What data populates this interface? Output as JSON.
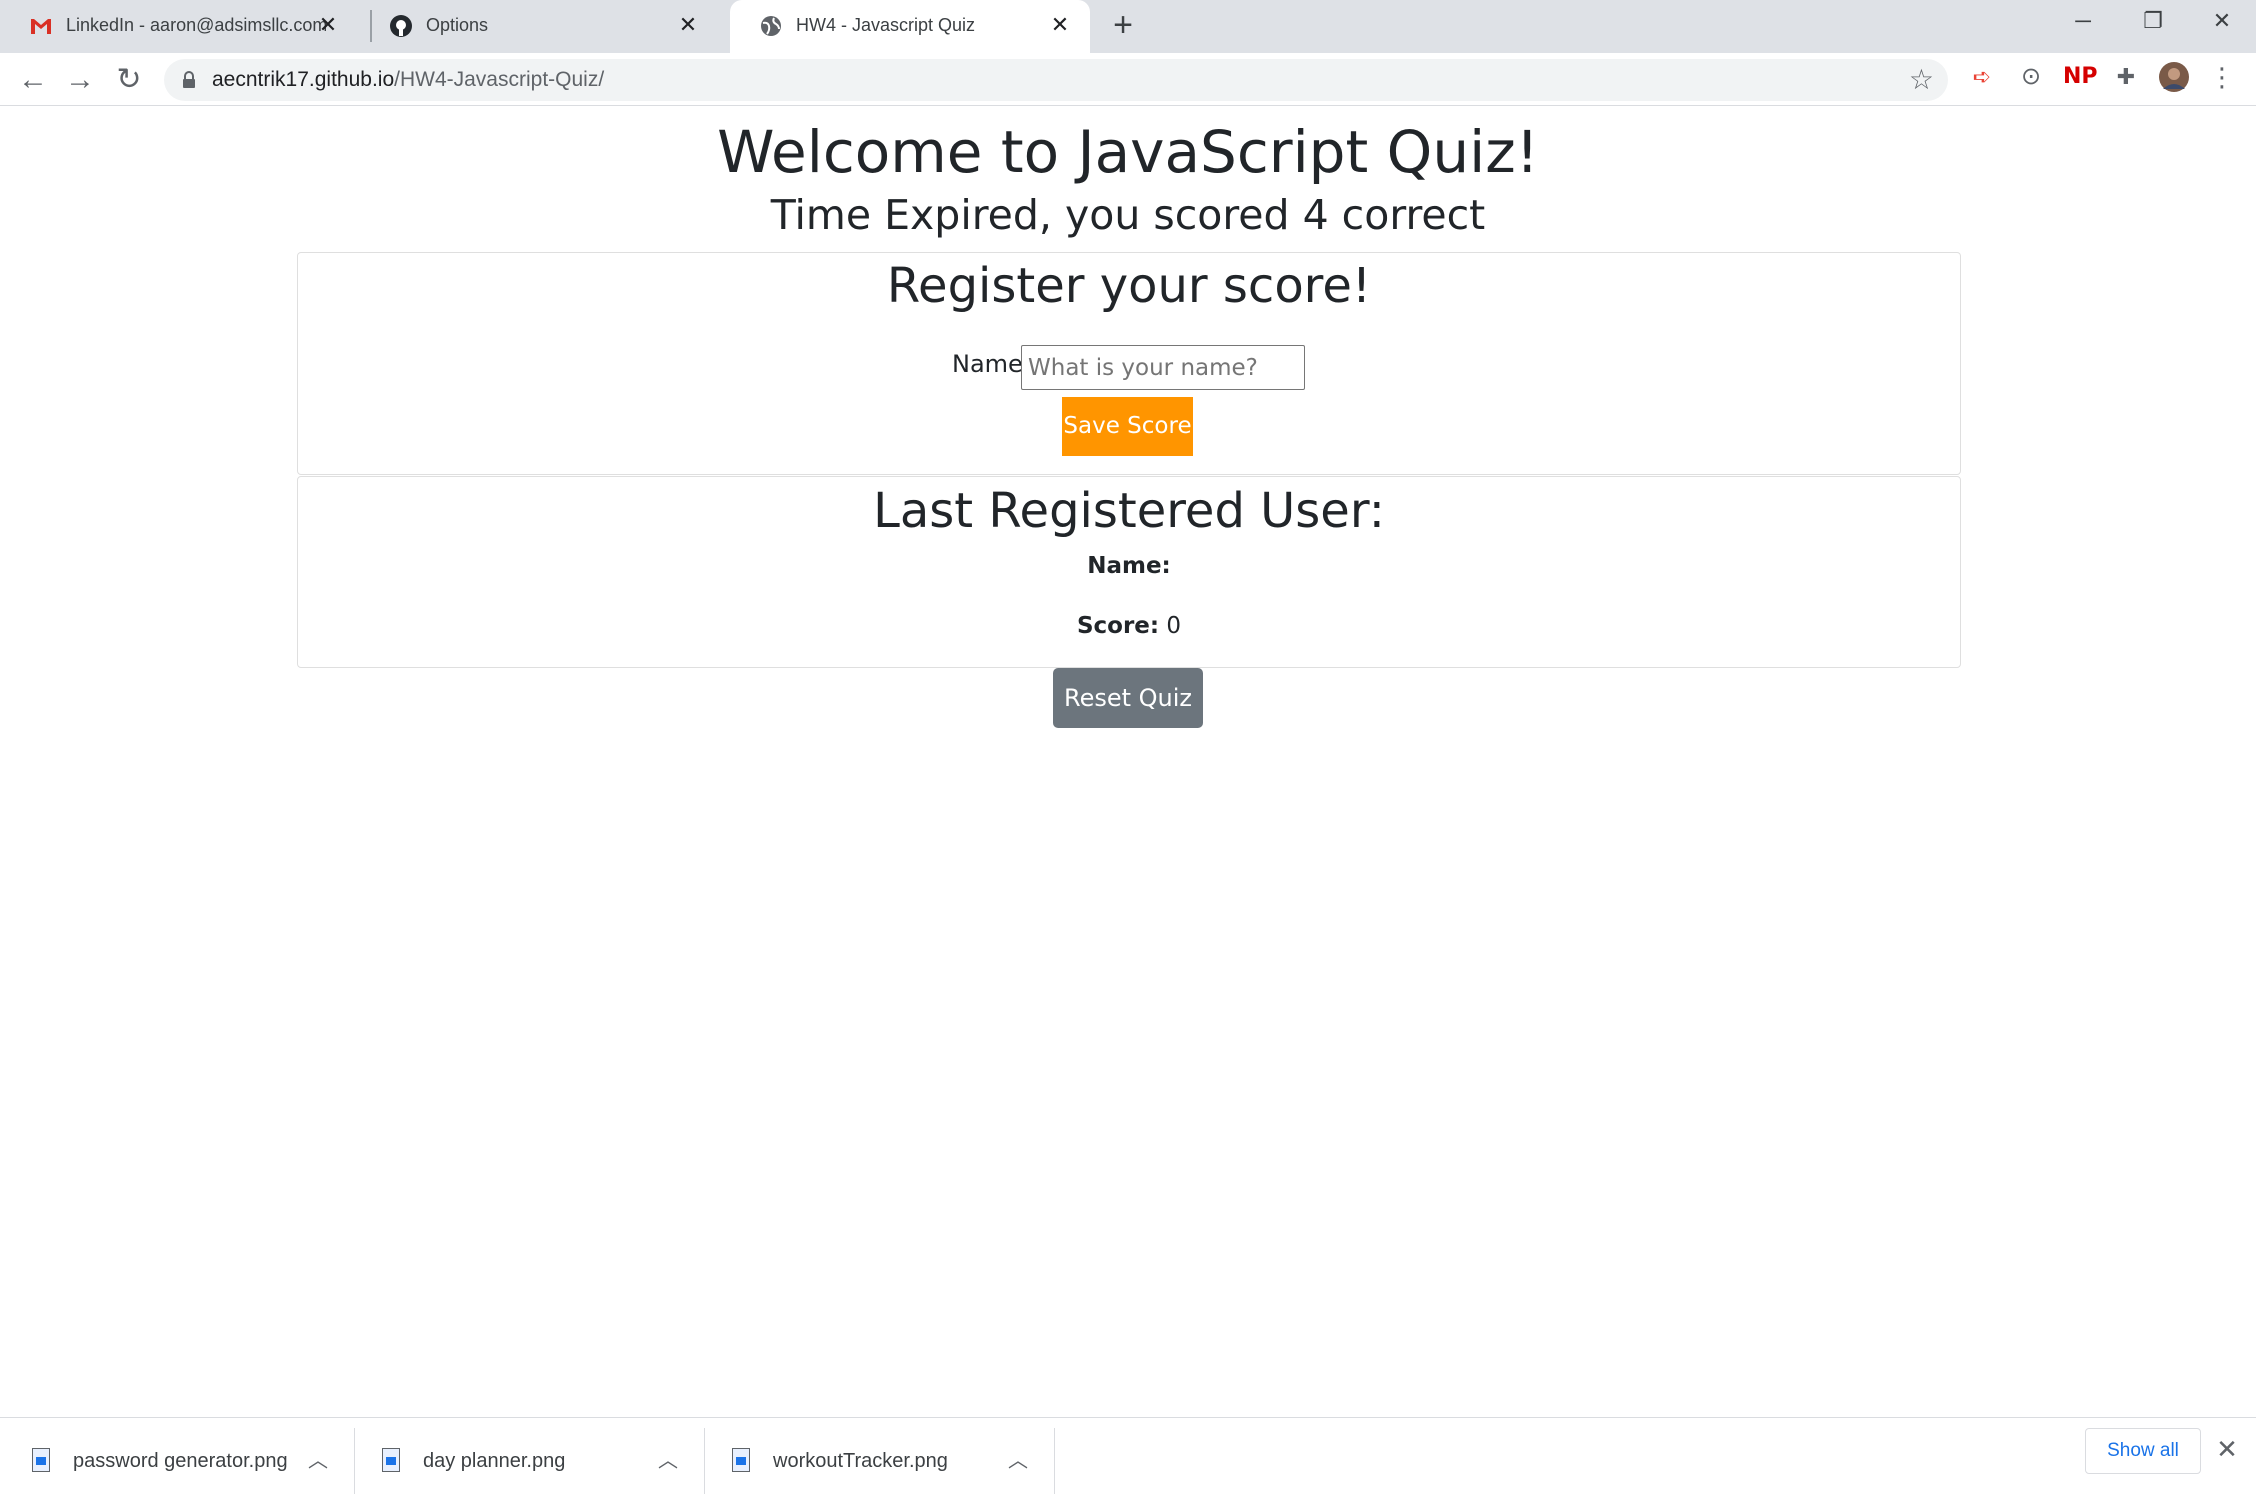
{
  "browser": {
    "tabs": [
      {
        "title": "LinkedIn - aaron@adsimsllc.com",
        "icon": "gmail-icon",
        "active": false
      },
      {
        "title": "Options",
        "icon": "github-icon",
        "active": false
      },
      {
        "title": "HW4 - Javascript Quiz",
        "icon": "globe-icon",
        "active": true
      }
    ],
    "address": {
      "host": "aecntrik17.github.io",
      "path": "/HW4-Javascript-Quiz/"
    },
    "extensions": {
      "np_label": "NP"
    }
  },
  "page": {
    "title": "Welcome to JavaScript Quiz!",
    "subtitle": "Time Expired, you scored 4 correct",
    "register": {
      "heading": "Register your score!",
      "name_label": "Name",
      "name_placeholder": "What is your name?",
      "name_value": "",
      "save_button": "Save Score"
    },
    "last_user": {
      "heading": "Last Registered User:",
      "name_label": "Name:",
      "name_value": "",
      "score_label": "Score:",
      "score_value": "0"
    },
    "reset_button": "Reset Quiz"
  },
  "downloads": {
    "items": [
      {
        "filename": "password generator.png"
      },
      {
        "filename": "day planner.png"
      },
      {
        "filename": "workoutTracker.png"
      }
    ],
    "show_all": "Show all"
  },
  "colors": {
    "save_button": "#ff9500",
    "reset_button": "#6c757d",
    "link_blue": "#1a73e8"
  }
}
